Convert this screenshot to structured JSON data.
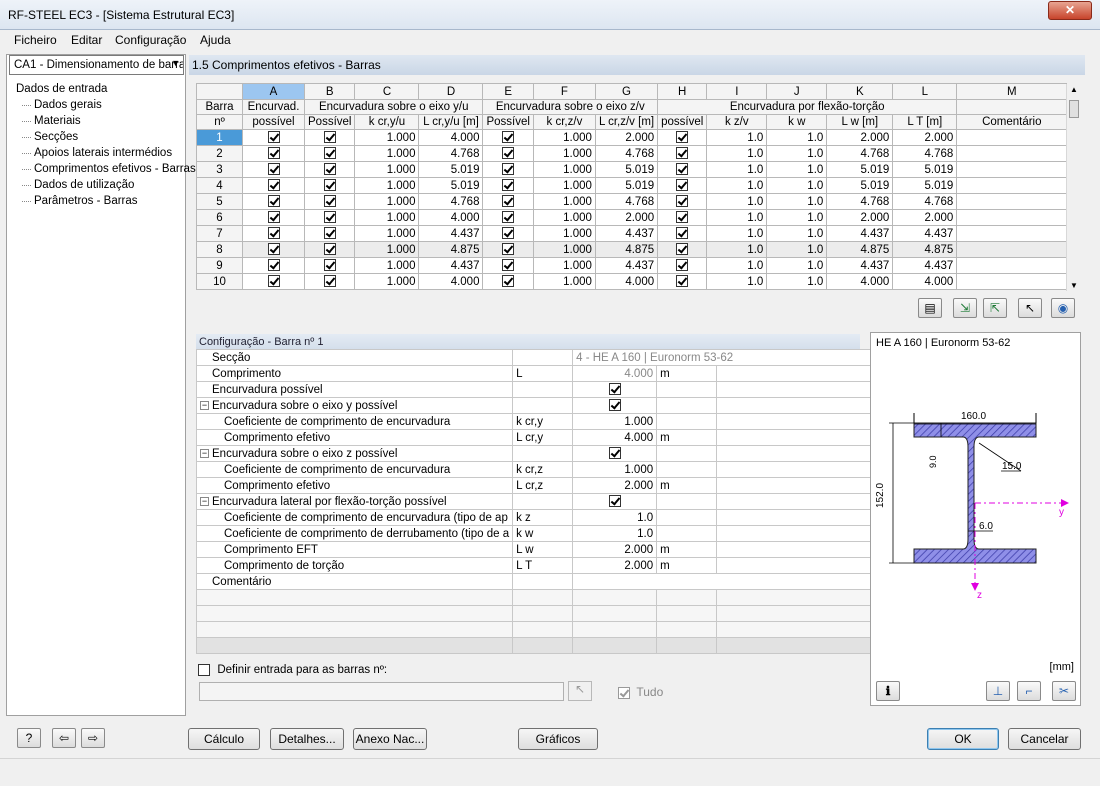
{
  "window": {
    "title": "RF-STEEL EC3 - [Sistema Estrutural EC3]",
    "close_label": "✕"
  },
  "menu": [
    "Ficheiro",
    "Editar",
    "Configuração",
    "Ajuda"
  ],
  "case_select": "CA1 - Dimensionamento de barra",
  "tree": {
    "root": "Dados de entrada",
    "items": [
      "Dados gerais",
      "Materiais",
      "Secções",
      "Apoios laterais intermédios",
      "Comprimentos efetivos - Barras",
      "Dados de utilização",
      "Parâmetros - Barras"
    ]
  },
  "section_title": "1.5 Comprimentos efetivos - Barras",
  "table": {
    "col_letters": [
      "A",
      "B",
      "C",
      "D",
      "E",
      "F",
      "G",
      "H",
      "I",
      "J",
      "K",
      "L",
      "M"
    ],
    "h_barra": "Barra",
    "h_no": "nº",
    "h_encurvad": "Encurvad.",
    "h_possivel": "possível",
    "group_y": "Encurvadura sobre o eixo y/u",
    "group_z": "Encurvadura sobre o eixo z/v",
    "group_lt": "Encurvadura por flexão-torção",
    "sub": [
      "Possível",
      "k cr,y/u",
      "L cr,y/u [m]",
      "Possível",
      "k cr,z/v",
      "L cr,z/v [m]",
      "possível",
      "k z/v",
      "k w",
      "L w [m]",
      "L T [m]",
      "Comentário"
    ],
    "rows": [
      {
        "no": "1",
        "kcy": "1.000",
        "lcy": "4.000",
        "kcz": "1.000",
        "lcz": "2.000",
        "kz": "1.0",
        "kw": "1.0",
        "lw": "2.000",
        "lt": "2.000"
      },
      {
        "no": "2",
        "kcy": "1.000",
        "lcy": "4.768",
        "kcz": "1.000",
        "lcz": "4.768",
        "kz": "1.0",
        "kw": "1.0",
        "lw": "4.768",
        "lt": "4.768"
      },
      {
        "no": "3",
        "kcy": "1.000",
        "lcy": "5.019",
        "kcz": "1.000",
        "lcz": "5.019",
        "kz": "1.0",
        "kw": "1.0",
        "lw": "5.019",
        "lt": "5.019"
      },
      {
        "no": "4",
        "kcy": "1.000",
        "lcy": "5.019",
        "kcz": "1.000",
        "lcz": "5.019",
        "kz": "1.0",
        "kw": "1.0",
        "lw": "5.019",
        "lt": "5.019"
      },
      {
        "no": "5",
        "kcy": "1.000",
        "lcy": "4.768",
        "kcz": "1.000",
        "lcz": "4.768",
        "kz": "1.0",
        "kw": "1.0",
        "lw": "4.768",
        "lt": "4.768"
      },
      {
        "no": "6",
        "kcy": "1.000",
        "lcy": "4.000",
        "kcz": "1.000",
        "lcz": "2.000",
        "kz": "1.0",
        "kw": "1.0",
        "lw": "2.000",
        "lt": "2.000"
      },
      {
        "no": "7",
        "kcy": "1.000",
        "lcy": "4.437",
        "kcz": "1.000",
        "lcz": "4.437",
        "kz": "1.0",
        "kw": "1.0",
        "lw": "4.437",
        "lt": "4.437"
      },
      {
        "no": "8",
        "kcy": "1.000",
        "lcy": "4.875",
        "kcz": "1.000",
        "lcz": "4.875",
        "kz": "1.0",
        "kw": "1.0",
        "lw": "4.875",
        "lt": "4.875"
      },
      {
        "no": "9",
        "kcy": "1.000",
        "lcy": "4.437",
        "kcz": "1.000",
        "lcz": "4.437",
        "kz": "1.0",
        "kw": "1.0",
        "lw": "4.437",
        "lt": "4.437"
      },
      {
        "no": "10",
        "kcy": "1.000",
        "lcy": "4.000",
        "kcz": "1.000",
        "lcz": "4.000",
        "kz": "1.0",
        "kw": "1.0",
        "lw": "4.000",
        "lt": "4.000"
      }
    ]
  },
  "toolbar_icons": [
    "table-view-icon",
    "export-excel-icon",
    "import-excel-icon",
    "select-member-icon",
    "view-icon"
  ],
  "config": {
    "title": "Configuração - Barra nº 1",
    "rows": [
      {
        "label": "Secção",
        "sym": "",
        "val": "4 - HE A 160 | Euronorm 53-62",
        "unit": ""
      },
      {
        "label": "Comprimento",
        "sym": "L",
        "val": "4.000",
        "unit": "m"
      },
      {
        "label": "Encurvadura possível",
        "sym": "",
        "val": "",
        "unit": ""
      },
      {
        "label": "Encurvadura sobre o eixo y possível",
        "sym": "",
        "val": "",
        "unit": ""
      },
      {
        "label": "Coeficiente de comprimento de encurvadura",
        "sym": "k cr,y",
        "val": "1.000",
        "unit": ""
      },
      {
        "label": "Comprimento efetivo",
        "sym": "L cr,y",
        "val": "4.000",
        "unit": "m"
      },
      {
        "label": "Encurvadura sobre o eixo z possível",
        "sym": "",
        "val": "",
        "unit": ""
      },
      {
        "label": "Coeficiente de comprimento de encurvadura",
        "sym": "k cr,z",
        "val": "1.000",
        "unit": ""
      },
      {
        "label": "Comprimento efetivo",
        "sym": "L cr,z",
        "val": "2.000",
        "unit": "m"
      },
      {
        "label": "Encurvadura lateral por flexão-torção possível",
        "sym": "",
        "val": "",
        "unit": ""
      },
      {
        "label": "Coeficiente de comprimento de encurvadura (tipo de ap",
        "sym": "k z",
        "val": "1.0",
        "unit": ""
      },
      {
        "label": "Coeficiente de comprimento de derrubamento (tipo de a",
        "sym": "k w",
        "val": "1.0",
        "unit": ""
      },
      {
        "label": "Comprimento EFT",
        "sym": "L w",
        "val": "2.000",
        "unit": "m"
      },
      {
        "label": "Comprimento de torção",
        "sym": "L T",
        "val": "2.000",
        "unit": "m"
      },
      {
        "label": "Comentário",
        "sym": "",
        "val": "",
        "unit": ""
      }
    ]
  },
  "section_preview": {
    "title": "HE A 160 | Euronorm 53-62",
    "dim_width": "160.0",
    "dim_height": "152.0",
    "dim_flange": "9.0",
    "dim_radius": "15.0",
    "dim_web": "6.0",
    "axis_y": "y",
    "axis_z": "z",
    "unit": "[mm]"
  },
  "define_input": {
    "label": "Definir entrada para as barras nº:",
    "all_label": "Tudo"
  },
  "buttons": {
    "calc": "Cálculo",
    "details": "Detalhes...",
    "annex": "Anexo Nac...",
    "graphics": "Gráficos",
    "ok": "OK",
    "cancel": "Cancelar"
  },
  "colors": {
    "accent": "#4a9ad8",
    "section_fill": "#6b6bd8",
    "axis": "#e000e0"
  }
}
